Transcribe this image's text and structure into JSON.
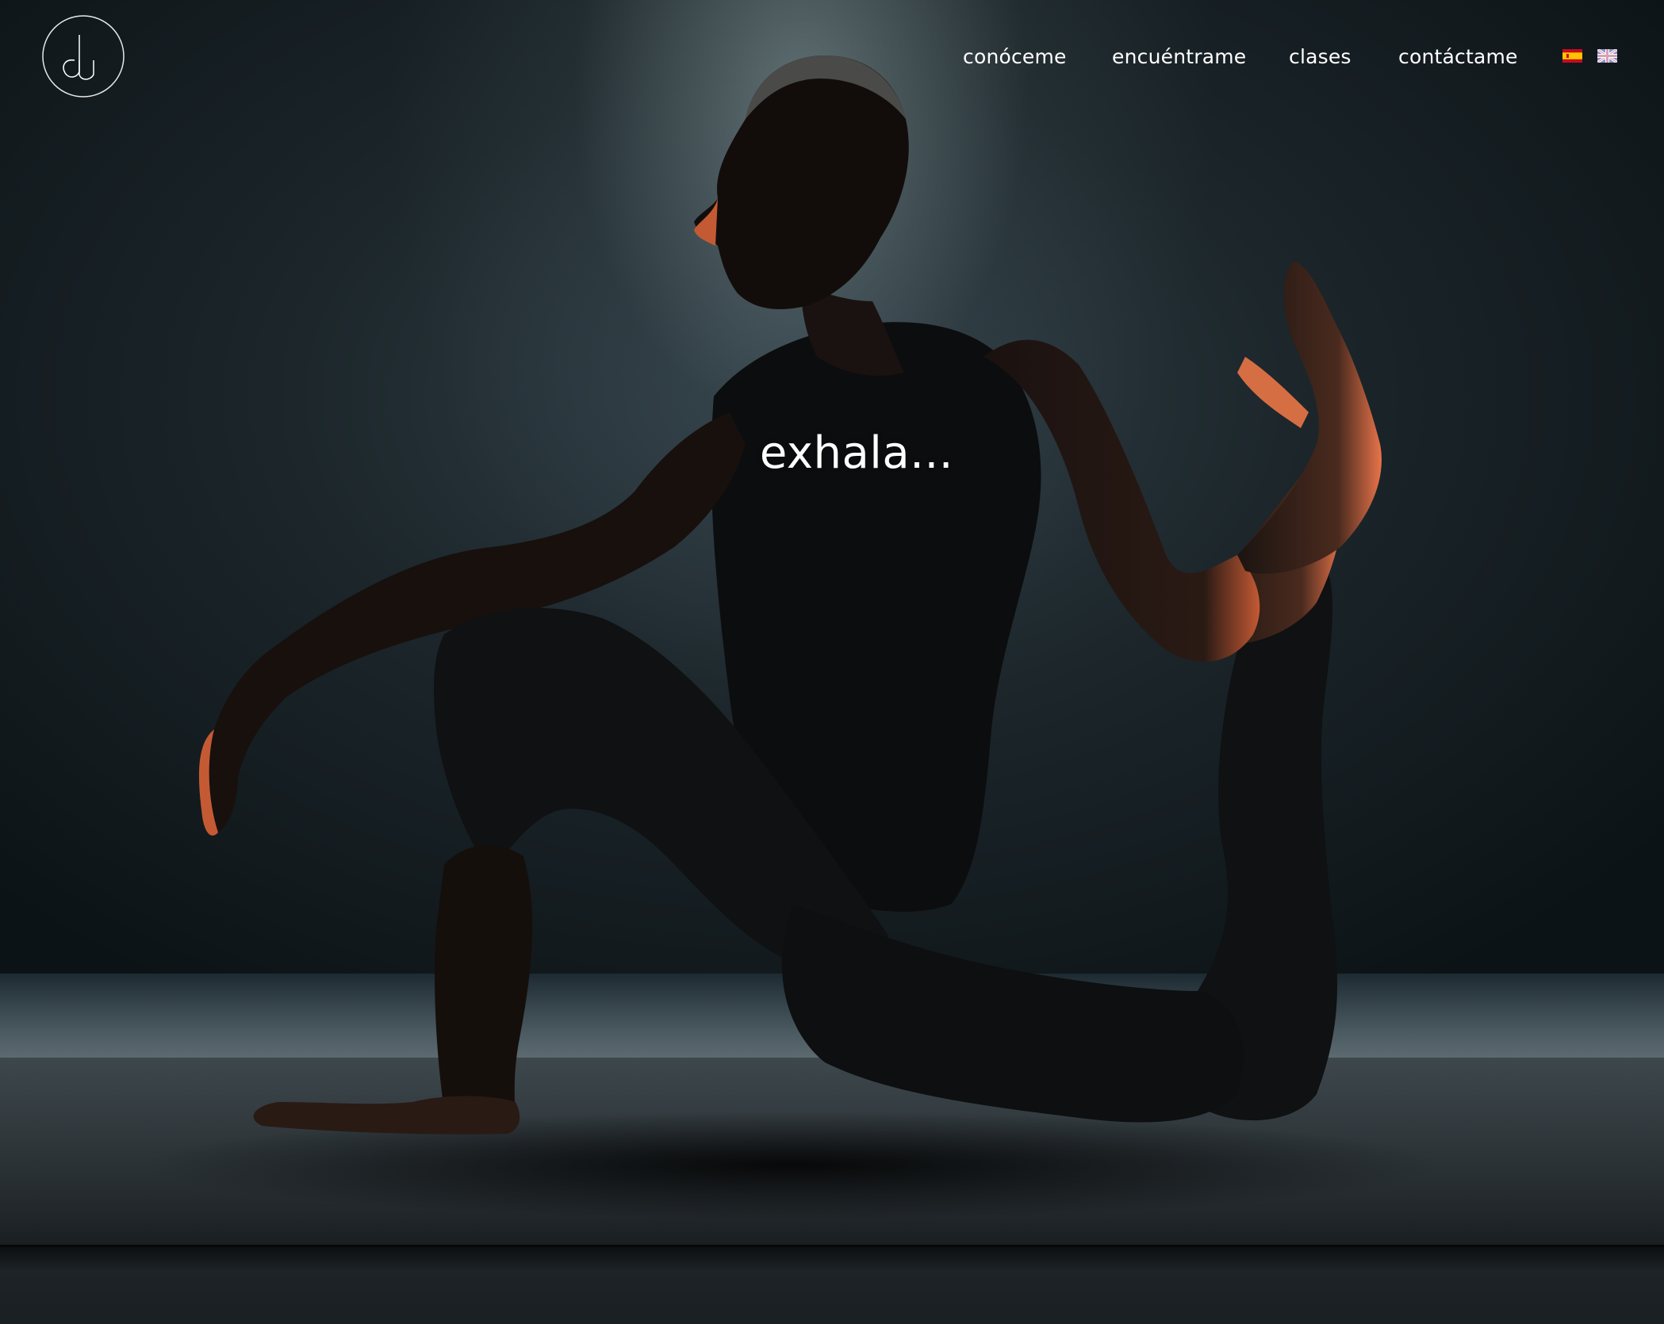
{
  "logo": {
    "text": "du",
    "icon": "monogram-logo"
  },
  "nav": {
    "links": [
      {
        "label": "conóceme"
      },
      {
        "label": "encuéntrame"
      },
      {
        "label": "clases"
      },
      {
        "label": "contáctame"
      }
    ],
    "languages": [
      {
        "icon": "spain-flag-icon",
        "code": "es"
      },
      {
        "icon": "uk-flag-icon",
        "code": "en"
      }
    ]
  },
  "hero": {
    "headline": "exhala...",
    "image": "yoga-figure-photo"
  },
  "colors": {
    "text": "#ffffff",
    "background_dark": "#0c1316",
    "background_mid": "#33424a",
    "rim_light": "#e8744a"
  }
}
